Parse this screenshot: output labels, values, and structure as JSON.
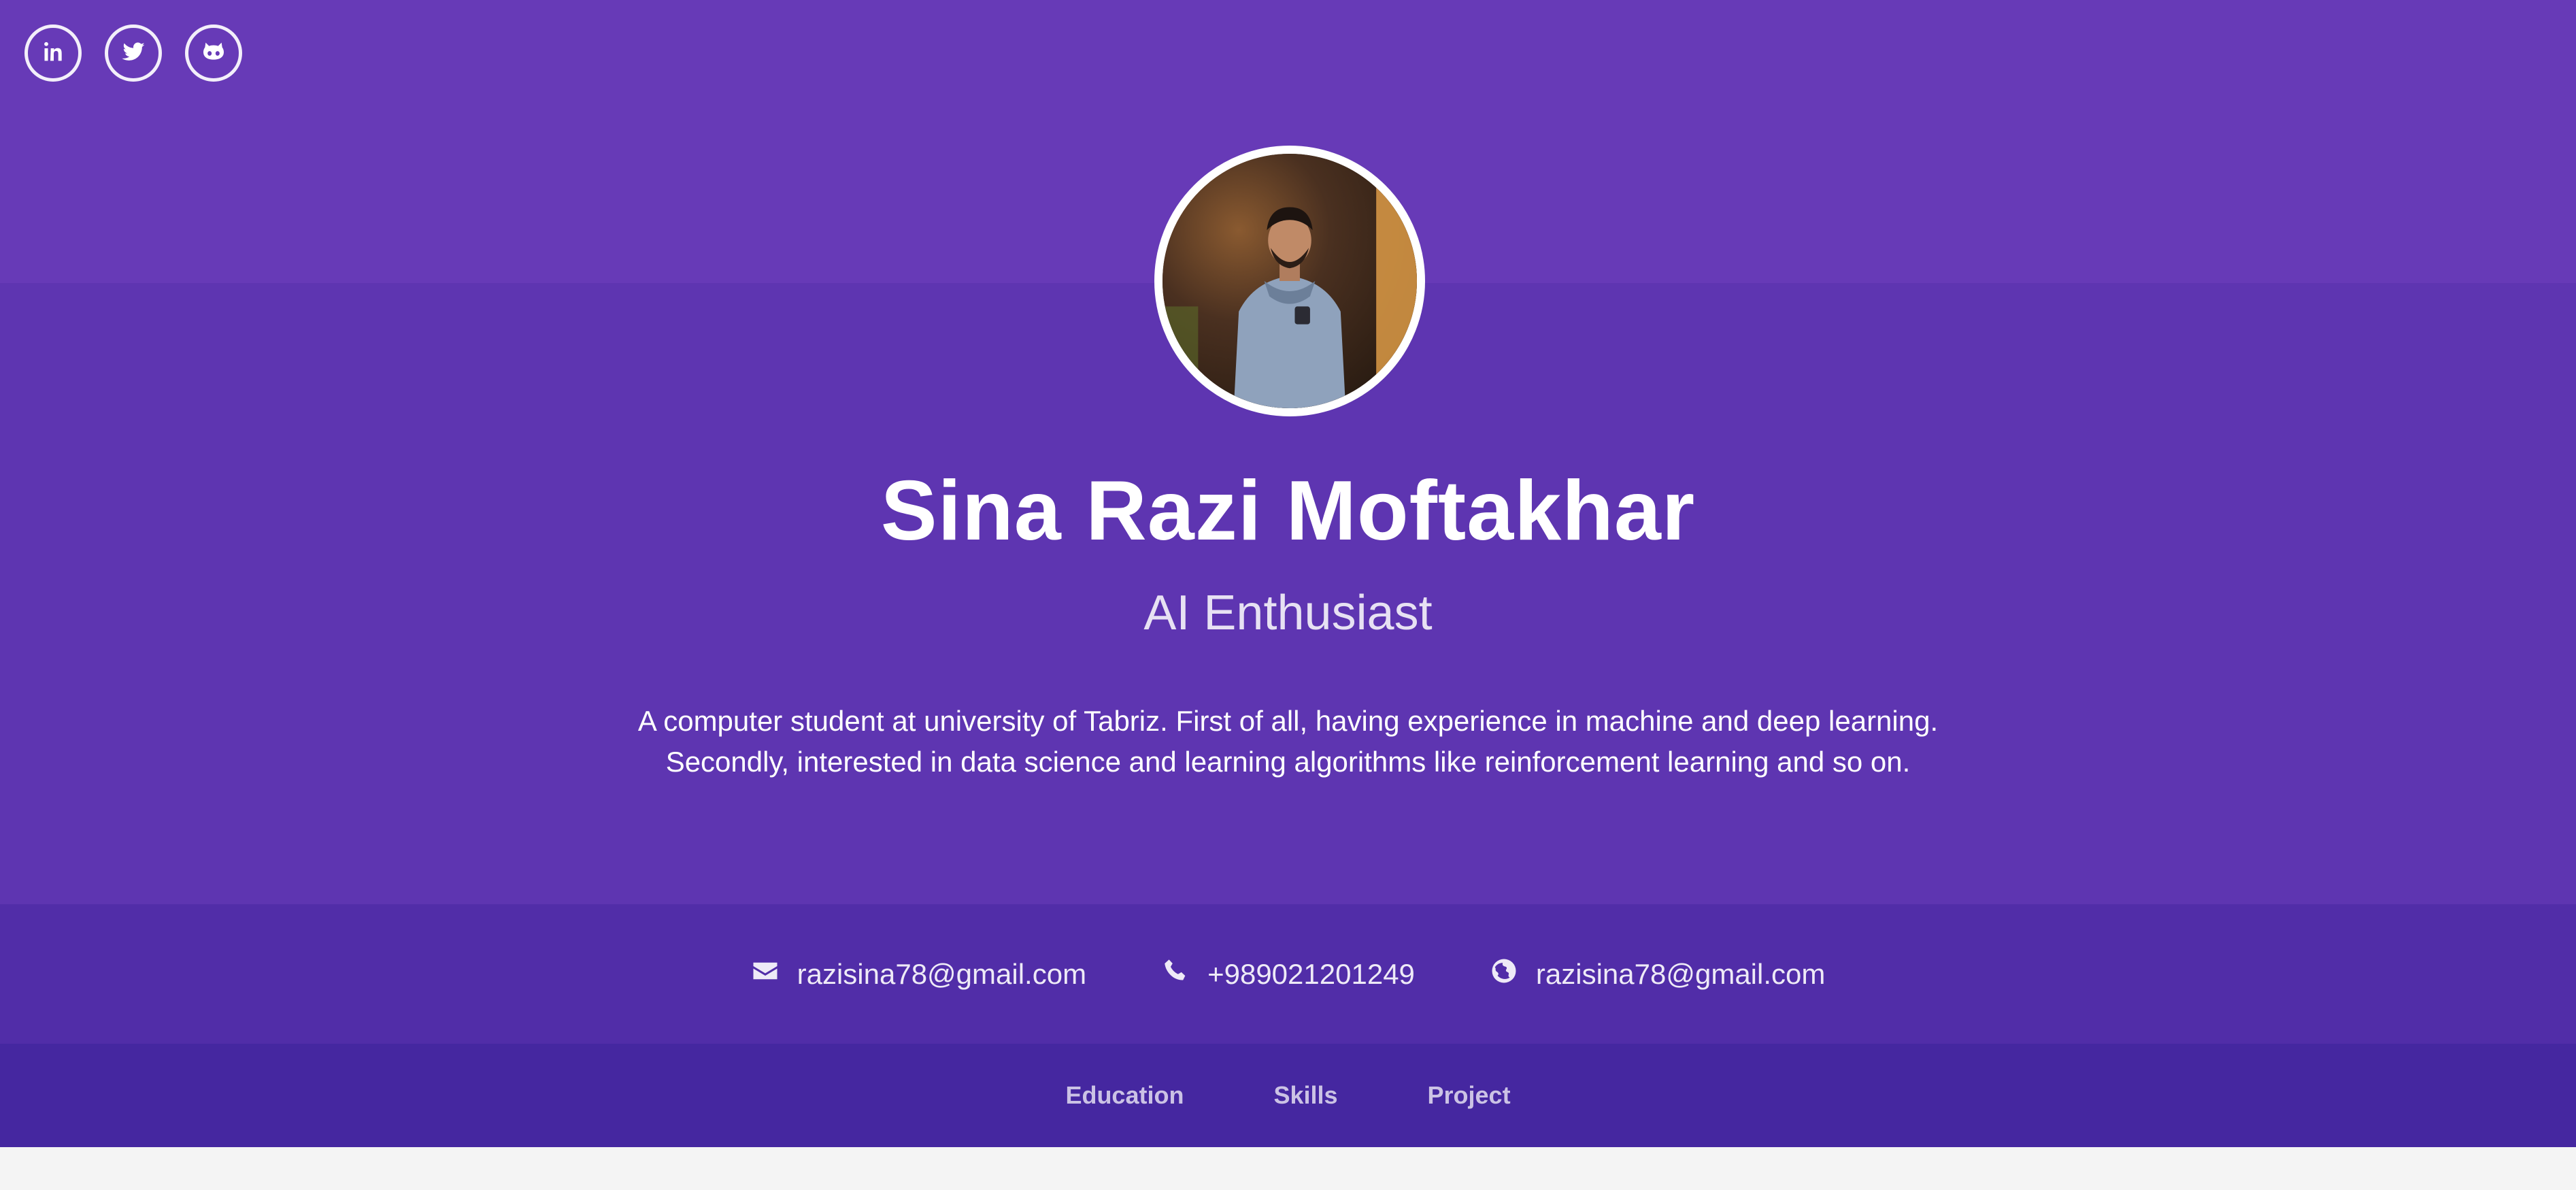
{
  "social": [
    {
      "name": "LinkedIn",
      "icon": "linkedin-icon"
    },
    {
      "name": "Twitter",
      "icon": "twitter-icon"
    },
    {
      "name": "GitHub",
      "icon": "github-icon"
    }
  ],
  "profile": {
    "name": "Sina Razi Moftakhar",
    "role": "AI Enthusiast",
    "bio": "A computer student at university of Tabriz. First of all, having experience in machine and deep learning. Secondly, interested in data science and learning algorithms like reinforcement learning and so on."
  },
  "contacts": {
    "email": {
      "icon": "envelope-icon",
      "text": "razisina78@gmail.com"
    },
    "phone": {
      "icon": "phone-icon",
      "text": "+989021201249"
    },
    "website": {
      "icon": "globe-icon",
      "text": "razisina78@gmail.com"
    }
  },
  "nav": {
    "items": [
      {
        "label": "Education"
      },
      {
        "label": "Skills"
      },
      {
        "label": "Project"
      }
    ]
  },
  "colors": {
    "header_top": "#673ab7",
    "header_main": "#5e35b1",
    "contact_bar": "#512da8",
    "nav_bar": "#4527a0",
    "page_background": "#f4f4f4"
  }
}
